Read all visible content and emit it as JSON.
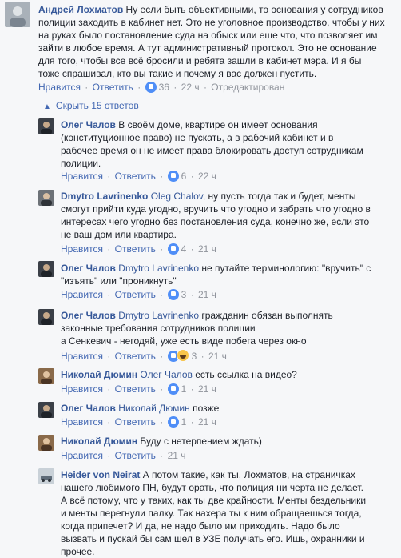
{
  "top_comment": {
    "author": "Андрей Лохматов",
    "lines": [
      "Ну если быть объективными, то основания у сотрудников",
      "полиции заходить в кабинет нет. Это не уголовное производство, чтобы у них",
      "на руках было постановление суда на обыск или еще что, что позволяет им",
      "зайти в любое время. А тут административный протокол. Это не основание",
      "для того, чтобы все всё бросили и ребята зашли в кабинет мэра. И я бы",
      "тоже спрашивал, кто вы такие и почему я вас должен пустить."
    ],
    "like_label": "Нравится",
    "reply_label": "Ответить",
    "reactions": "36",
    "time": "22 ч",
    "edited": "Отредактирован"
  },
  "hide_replies_label": "Скрыть 15 ответов",
  "replies": [
    {
      "author": "Олег Чалов",
      "mention": "",
      "lines": [
        "В своём доме, квартире он имеет основания",
        "(конституционное право) не пускать, а в рабочий кабинет и в",
        "рабочее время он не имеет права блокировать доступ сотрудникам",
        "полиции."
      ],
      "like_label": "Нравится",
      "reply_label": "Ответить",
      "reactions": "6",
      "time": "22 ч"
    },
    {
      "author": "Dmytro Lavrinenko",
      "mention": "Oleg Chalov",
      "lines": [
        ", ну пусть тогда так и будет, менты",
        "смогут прийти куда угодно, вручить что угодно и забрать что угодно в",
        "интересах чего угодно без постановления суда, конечно же, если это",
        "не ваш дом или квартира."
      ],
      "like_label": "Нравится",
      "reply_label": "Ответить",
      "reactions": "4",
      "time": "21 ч"
    },
    {
      "author": "Олег Чалов",
      "mention": "Dmytro Lavrinenko",
      "lines": [
        " не путайте терминологию: \"вручить\" с",
        "\"изъять\" или \"проникнуть\""
      ],
      "like_label": "Нравится",
      "reply_label": "Ответить",
      "reactions": "3",
      "time": "21 ч"
    },
    {
      "author": "Олег Чалов",
      "mention": "Dmytro Lavrinenko",
      "lines": [
        " гражданин обязан выполнять",
        "законные требования сотрудников полиции",
        "а Сенкевич - негодяй, уже есть виде побега через окно"
      ],
      "like_label": "Нравится",
      "reply_label": "Ответить",
      "reactions": "3",
      "time": "21 ч"
    },
    {
      "author": "Николай Дюмин",
      "mention": "Олег Чалов",
      "lines": [
        " есть ссылка на видео?"
      ],
      "like_label": "Нравится",
      "reply_label": "Ответить",
      "reactions": "1",
      "time": "21 ч"
    },
    {
      "author": "Олег Чалов",
      "mention": "Николай Дюмин",
      "lines": [
        " позже"
      ],
      "like_label": "Нравится",
      "reply_label": "Ответить",
      "reactions": "1",
      "time": "21 ч"
    },
    {
      "author": "Николай Дюмин",
      "mention": "",
      "lines": [
        "Буду с нетерпением ждать)"
      ],
      "like_label": "Нравится",
      "reply_label": "Ответить",
      "reactions": "",
      "time": "21 ч"
    },
    {
      "author": "Heider von Neirat",
      "mention": "",
      "lines": [
        "А потом такие, как ты, Лохматов, на страничках",
        "нашего любимого ПН, будут орать, что полиция ни черта не делает.",
        "А всё потому, что у таких, как ты две крайности. Менты бездельники",
        "и менты перегнули палку. Так нахера ты к ним обращаешься тогда,",
        "когда припечет? И да, не надо было им приходить. Надо было",
        "вызвать и пускай бы сам шел в УЗЕ получать его. Ишь, охранники и",
        "прочее."
      ],
      "like_label": "",
      "reply_label": "",
      "reactions": "",
      "time": ""
    }
  ],
  "colors": {
    "background": "#f6f7f9",
    "link": "#4267b2",
    "author": "#365899",
    "meta": "#90949c",
    "text": "#1d2129"
  }
}
